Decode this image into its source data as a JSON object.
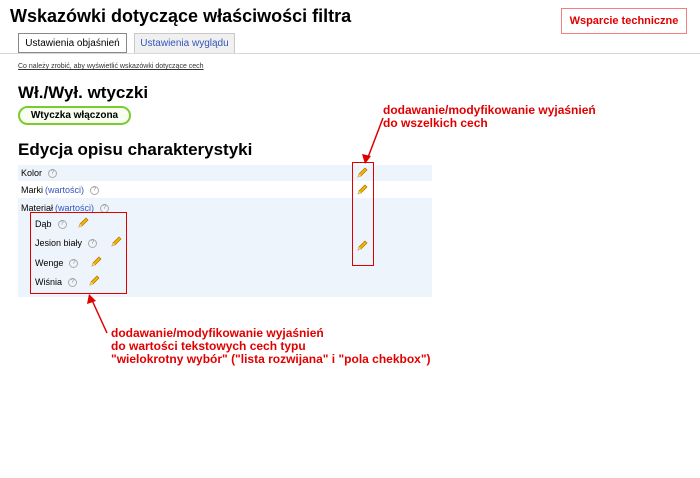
{
  "page": {
    "title": "Wskazówki dotyczące właściwości filtra",
    "support_button": "Wsparcie techniczne"
  },
  "tabs": [
    {
      "label": "Ustawienia objaśnień",
      "active": true
    },
    {
      "label": "Ustawienia wyglądu",
      "active": false
    }
  ],
  "hint_link": "Co należy zrobić, aby wyświetlić wskazówki dotyczące cech",
  "plugin": {
    "heading": "Wł./Wył. wtyczki",
    "toggle_label": "Wtyczka włączona"
  },
  "features": {
    "heading": "Edycja opisu charakterystyki",
    "items": [
      {
        "name": "Kolor",
        "link": ""
      },
      {
        "name": "Marki",
        "link": "(wartości)"
      },
      {
        "name": "Materiał",
        "link": "(wartości)"
      }
    ],
    "values": [
      "Dąb",
      "Jesion biały",
      "Wenge",
      "Wiśnia"
    ]
  },
  "annotations": {
    "top_line1": "dodawanie/modyfikowanie wyjaśnień",
    "top_line2": "do wszelkich cech",
    "bottom_line1": "dodawanie/modyfikowanie wyjaśnień",
    "bottom_line2": "do wartości tekstowych cech typu",
    "bottom_line3": "\"wielokrotny wybór\" (\"lista rozwijana\" i \"pola chekbox\")"
  },
  "colors": {
    "annotation": "#e00000",
    "toggle_border": "#7acb2f",
    "link": "#3355bb"
  },
  "icons": {
    "help": "question-circle-icon",
    "edit": "pencil-icon"
  }
}
